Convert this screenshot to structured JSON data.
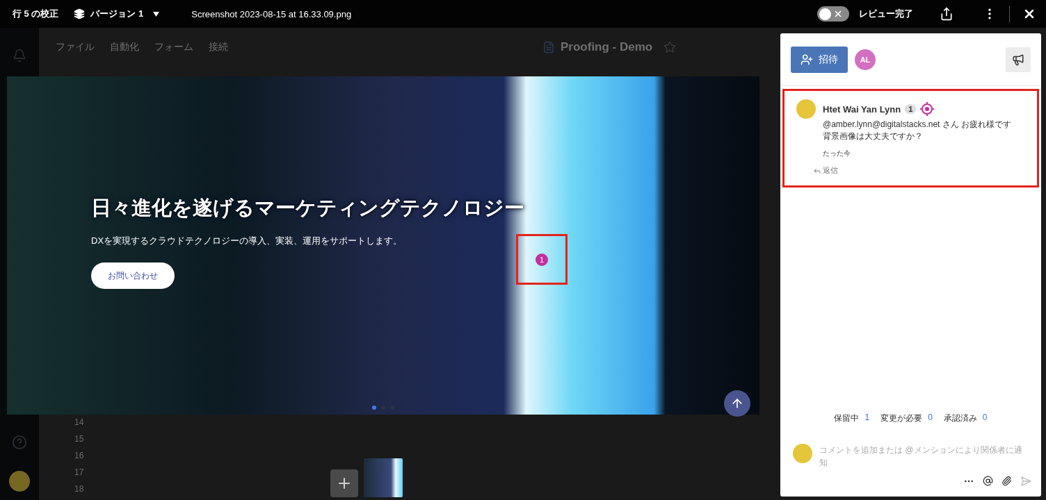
{
  "top_bar": {
    "title": "行 5 の校正",
    "version": "バージョン 1",
    "file_name": "Screenshot 2023-08-15 at 16.33.09.png",
    "review_complete": {
      "label": "レビュー完了",
      "on": false
    }
  },
  "background": {
    "menu": [
      "ファイル",
      "自動化",
      "フォーム",
      "接続"
    ],
    "document_title": "Proofing - Demo",
    "row_numbers": [
      "14",
      "15",
      "16",
      "17",
      "18"
    ]
  },
  "preview": {
    "heading": "日々進化を遂げるマーケティングテクノロジー",
    "subtitle": "DXを実現するクラウドテクノロジーの導入、実装、運用をサポートします。",
    "cta": "お問い合わせ",
    "marker": "1",
    "slides": [
      {
        "selected": true
      },
      {
        "selected": false
      },
      {
        "selected": false
      }
    ]
  },
  "panel": {
    "invite": "招待",
    "participants": [
      {
        "initials": "AL",
        "color": "#d36fc0"
      }
    ],
    "comments": [
      {
        "author": "Htet Wai Yan Lynn",
        "badge": "1",
        "highlighted": true,
        "body": [
          "@amber.lynn@digitalstacks.net さん お疲れ様です",
          "背景画像は大丈夫ですか？"
        ],
        "time": "たった今",
        "reply": "返信"
      }
    ],
    "status": [
      {
        "label": "保留中",
        "count": "1"
      },
      {
        "label": "変更が必要",
        "count": "0"
      },
      {
        "label": "承認済み",
        "count": "0"
      }
    ],
    "composer": {
      "placeholder": "コメントを追加または @メンションにより関係者に通知"
    }
  }
}
